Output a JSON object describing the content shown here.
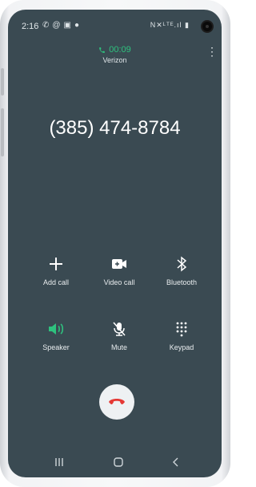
{
  "status": {
    "time": "2:16",
    "left_icons": [
      "phone-icon",
      "at-icon",
      "image-icon",
      "bulb-icon"
    ],
    "right_text": "N✕ᴸᵀᴱ.ıl ▮"
  },
  "call": {
    "duration": "00:09",
    "carrier": "Verizon",
    "number": "(385) 474-8784"
  },
  "actions": {
    "add_call": "Add call",
    "video_call": "Video call",
    "bluetooth": "Bluetooth",
    "speaker": "Speaker",
    "mute": "Mute",
    "keypad": "Keypad"
  },
  "colors": {
    "background": "#3a4a52",
    "active": "#2ec27e",
    "end_call": "#e53935"
  }
}
